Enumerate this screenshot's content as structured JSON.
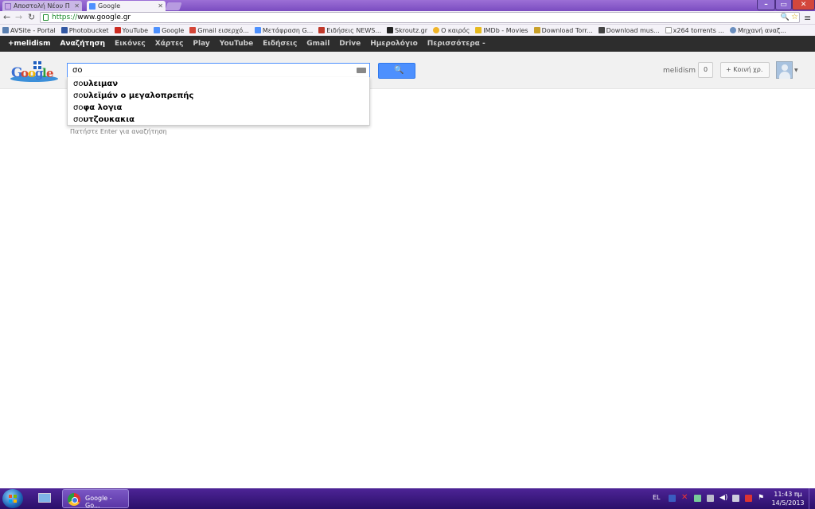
{
  "browser": {
    "tabs": [
      {
        "label": "Αποστολή Νέου Π",
        "active": false
      },
      {
        "label": "Google",
        "active": true
      }
    ],
    "omnibox": {
      "scheme": "https://",
      "host": "www.google.gr"
    },
    "bookmarks": [
      {
        "label": "AVSite - Portal",
        "color": "#5a7fb0"
      },
      {
        "label": "Photobucket",
        "color": "#3358a3"
      },
      {
        "label": "YouTube",
        "color": "#cc2b22"
      },
      {
        "label": "Google",
        "color": "#4d90fe"
      },
      {
        "label": "Gmail εισερχό...",
        "color": "#d44638"
      },
      {
        "label": "Μετάφραση G...",
        "color": "#4d90fe"
      },
      {
        "label": "Ειδήσεις NEWS...",
        "color": "#c0392b"
      },
      {
        "label": "Skroutz.gr",
        "color": "#222222"
      },
      {
        "label": "Ο καιρός",
        "color": "#f0b429"
      },
      {
        "label": "IMDb - Movies",
        "color": "#e6b91e"
      },
      {
        "label": "Download Torr...",
        "color": "#c8a02a"
      },
      {
        "label": "Download mus...",
        "color": "#444444"
      },
      {
        "label": "x264 torrents ...",
        "color": "#999999"
      },
      {
        "label": "Μηχανή αναζ...",
        "color": "#6b8fbf"
      }
    ]
  },
  "google_bar": {
    "items": [
      "+melidism",
      "Αναζήτηση",
      "Εικόνες",
      "Χάρτες",
      "Play",
      "YouTube",
      "Ειδήσεις",
      "Gmail",
      "Drive",
      "Ημερολόγιο",
      "Περισσότερα -"
    ],
    "active_index": 1
  },
  "header": {
    "search_value": "σο",
    "user_name": "melidism",
    "notifications": "0",
    "share_label": "Κοινή χρ."
  },
  "suggestions": [
    {
      "prefix": "σο",
      "rest": "υλειμαν"
    },
    {
      "prefix": "σο",
      "rest": "υλεϊμάν ο μεγαλοπρεπής"
    },
    {
      "prefix": "σο",
      "rest": "φα λογια"
    },
    {
      "prefix": "σο",
      "rest": "υτζουκακια"
    }
  ],
  "hint": "Πατήστε Enter για αναζήτηση",
  "taskbar": {
    "chrome_label": "Google - Go...",
    "language": "EL",
    "time": "11:43 πμ",
    "date": "14/5/2013"
  }
}
